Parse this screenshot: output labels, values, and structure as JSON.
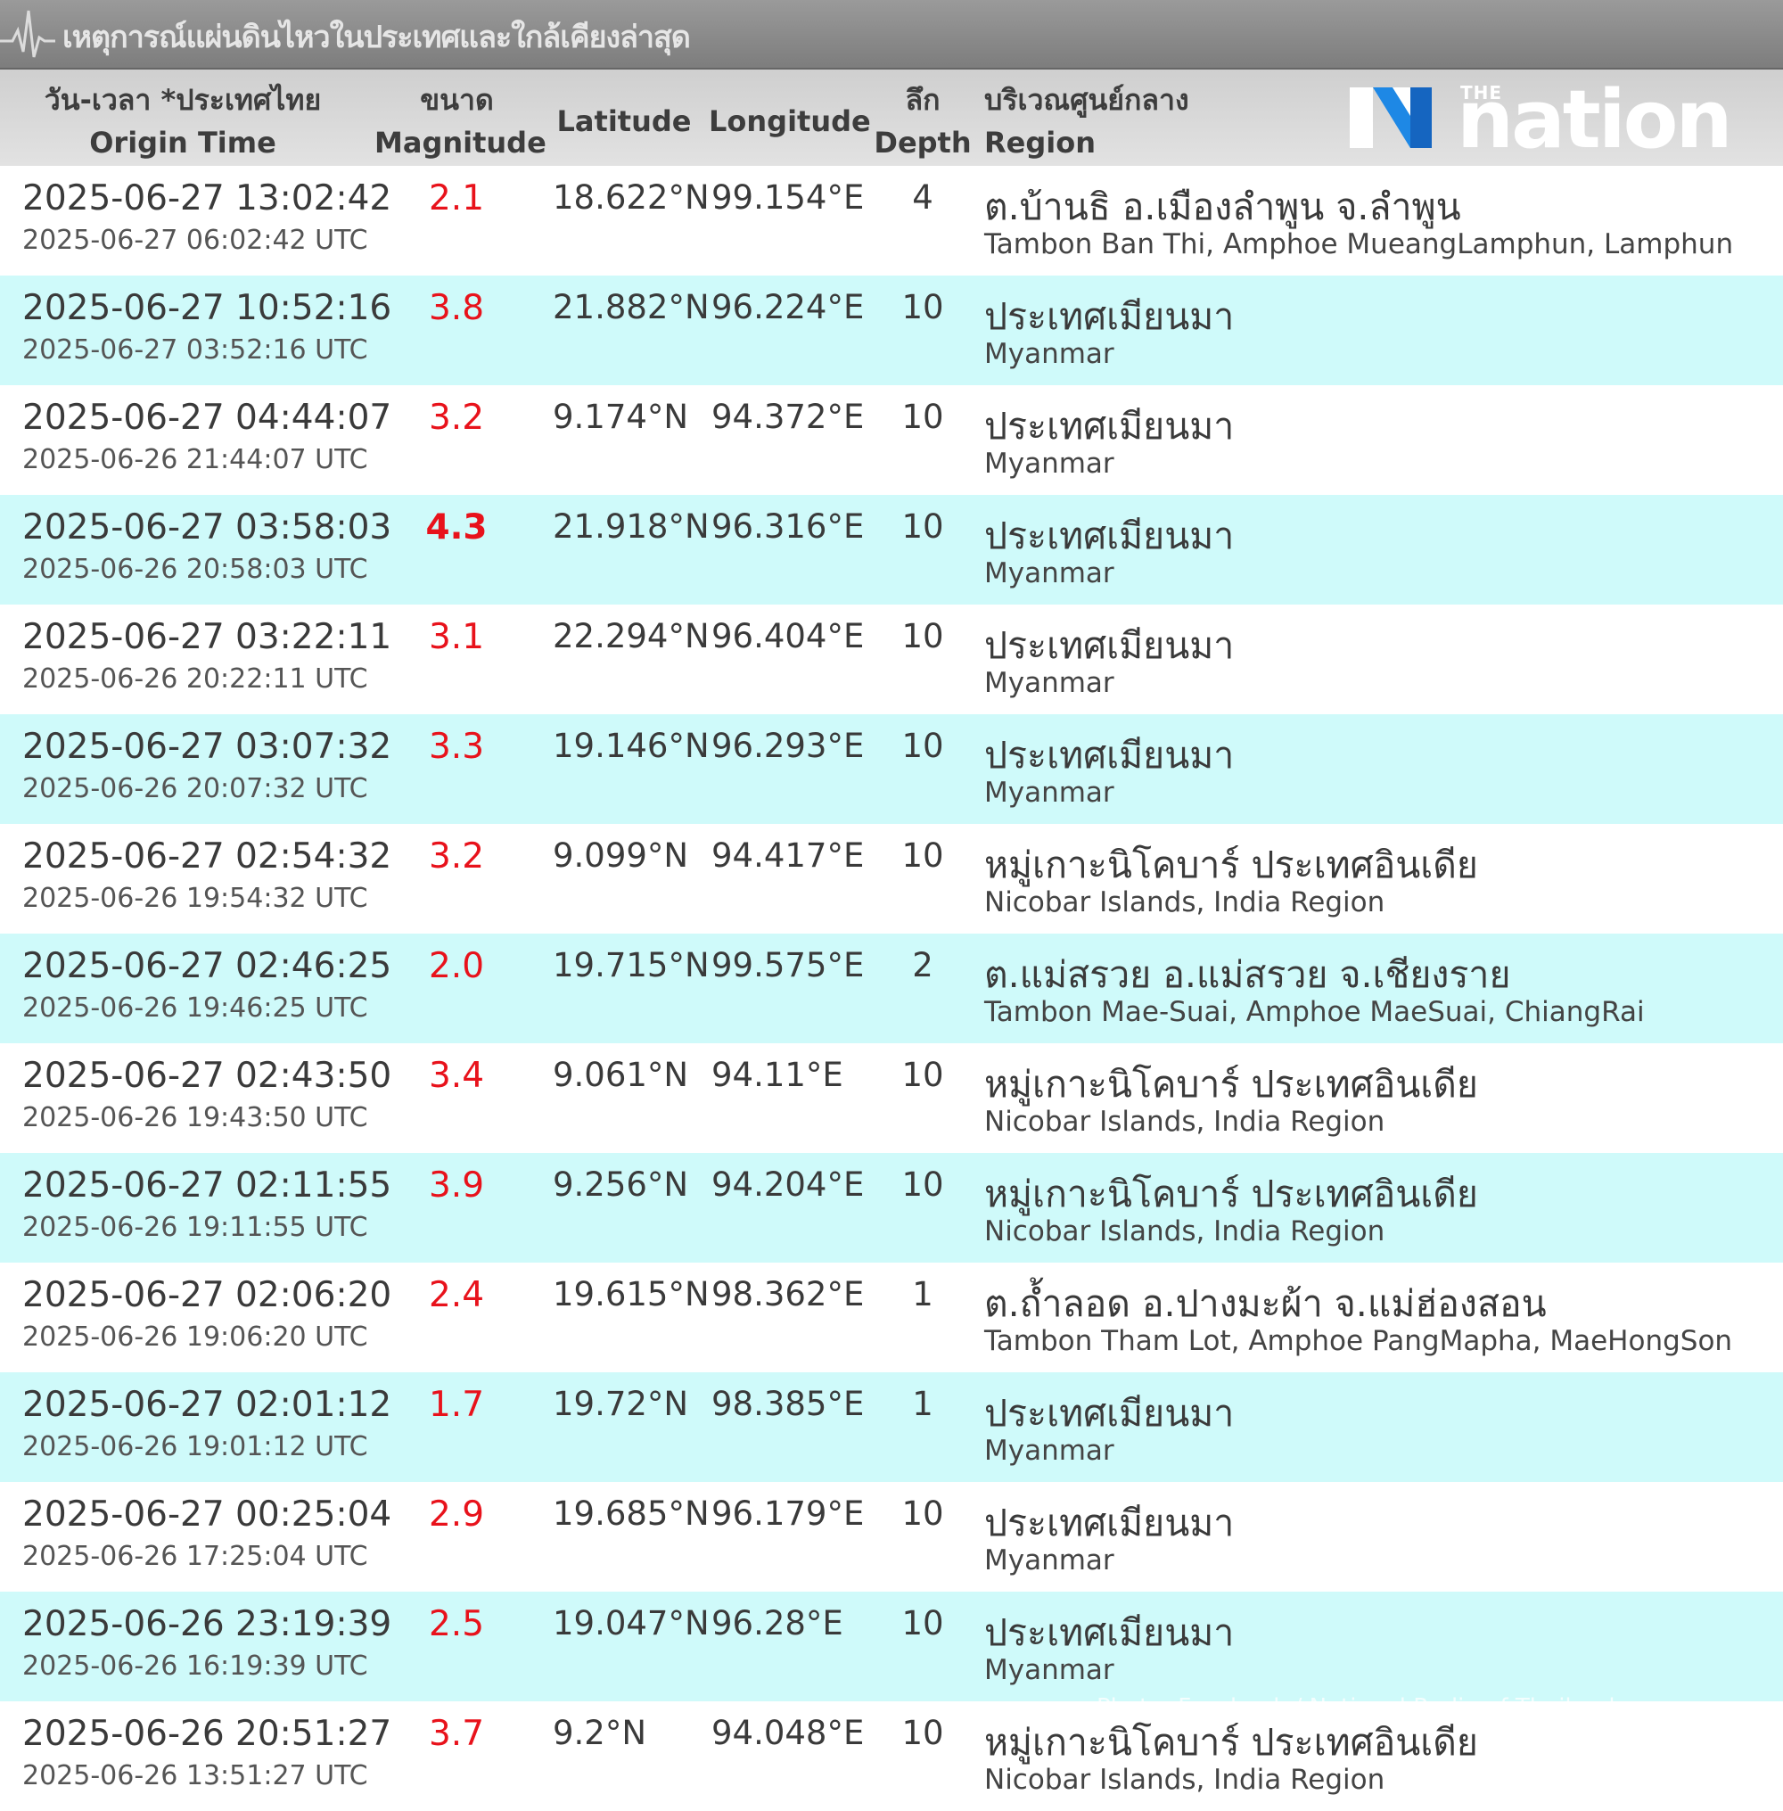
{
  "window": {
    "title": "เหตุการณ์แผ่นดินไหวในประเทศและใกล้เคียงล่าสุด"
  },
  "logo": {
    "small": "THE",
    "word": "nation",
    "brand_color": "#1e88e5"
  },
  "columns": {
    "time_th": "วัน-เวลา *ประเทศไทย",
    "time_en": "Origin Time",
    "mag_th": "ขนาด",
    "mag_en": "Magnitude",
    "lat": "Latitude",
    "lon": "Longitude",
    "depth_th": "ลึก",
    "depth_en": "Depth",
    "region_th": "บริเวณศูนย์กลาง",
    "region_en": "Region"
  },
  "colors": {
    "magnitude": "#e8121b",
    "alt_row": "#cffafa",
    "header_bg": "#d6d6d6"
  },
  "rows": [
    {
      "local": "2025-06-27 13:02:42",
      "utc": "2025-06-27 06:02:42 UTC",
      "mag": "2.1",
      "lat": "18.622°N",
      "lon": "99.154°E",
      "depth": "4",
      "region_th": "ต.บ้านธิ อ.เมืองลำพูน จ.ลำพูน",
      "region_en": "Tambon Ban Thi, Amphoe MueangLamphun, Lamphun"
    },
    {
      "local": "2025-06-27 10:52:16",
      "utc": "2025-06-27 03:52:16 UTC",
      "mag": "3.8",
      "lat": "21.882°N",
      "lon": "96.224°E",
      "depth": "10",
      "region_th": "ประเทศเมียนมา",
      "region_en": "Myanmar"
    },
    {
      "local": "2025-06-27 04:44:07",
      "utc": "2025-06-26 21:44:07 UTC",
      "mag": "3.2",
      "lat": "9.174°N",
      "lon": "94.372°E",
      "depth": "10",
      "region_th": "ประเทศเมียนมา",
      "region_en": "Myanmar"
    },
    {
      "local": "2025-06-27 03:58:03",
      "utc": "2025-06-26 20:58:03 UTC",
      "mag": "4.3",
      "lat": "21.918°N",
      "lon": "96.316°E",
      "depth": "10",
      "region_th": "ประเทศเมียนมา",
      "region_en": "Myanmar"
    },
    {
      "local": "2025-06-27 03:22:11",
      "utc": "2025-06-26 20:22:11 UTC",
      "mag": "3.1",
      "lat": "22.294°N",
      "lon": "96.404°E",
      "depth": "10",
      "region_th": "ประเทศเมียนมา",
      "region_en": "Myanmar"
    },
    {
      "local": "2025-06-27 03:07:32",
      "utc": "2025-06-26 20:07:32 UTC",
      "mag": "3.3",
      "lat": "19.146°N",
      "lon": "96.293°E",
      "depth": "10",
      "region_th": "ประเทศเมียนมา",
      "region_en": "Myanmar"
    },
    {
      "local": "2025-06-27 02:54:32",
      "utc": "2025-06-26 19:54:32 UTC",
      "mag": "3.2",
      "lat": "9.099°N",
      "lon": "94.417°E",
      "depth": "10",
      "region_th": "หมู่เกาะนิโคบาร์ ประเทศอินเดีย",
      "region_en": "Nicobar Islands, India Region"
    },
    {
      "local": "2025-06-27 02:46:25",
      "utc": "2025-06-26 19:46:25 UTC",
      "mag": "2.0",
      "lat": "19.715°N",
      "lon": "99.575°E",
      "depth": "2",
      "region_th": "ต.แม่สรวย อ.แม่สรวย จ.เชียงราย",
      "region_en": "Tambon Mae-Suai, Amphoe MaeSuai, ChiangRai"
    },
    {
      "local": "2025-06-27 02:43:50",
      "utc": "2025-06-26 19:43:50 UTC",
      "mag": "3.4",
      "lat": "9.061°N",
      "lon": "94.11°E",
      "depth": "10",
      "region_th": "หมู่เกาะนิโคบาร์ ประเทศอินเดีย",
      "region_en": "Nicobar Islands, India Region"
    },
    {
      "local": "2025-06-27 02:11:55",
      "utc": "2025-06-26 19:11:55 UTC",
      "mag": "3.9",
      "lat": "9.256°N",
      "lon": "94.204°E",
      "depth": "10",
      "region_th": "หมู่เกาะนิโคบาร์ ประเทศอินเดีย",
      "region_en": "Nicobar Islands, India Region"
    },
    {
      "local": "2025-06-27 02:06:20",
      "utc": "2025-06-26 19:06:20 UTC",
      "mag": "2.4",
      "lat": "19.615°N",
      "lon": "98.362°E",
      "depth": "1",
      "region_th": "ต.ถ้ำลอด อ.ปางมะผ้า จ.แม่ฮ่องสอน",
      "region_en": "Tambon Tham Lot, Amphoe PangMapha, MaeHongSon"
    },
    {
      "local": "2025-06-27 02:01:12",
      "utc": "2025-06-26 19:01:12 UTC",
      "mag": "1.7",
      "lat": "19.72°N",
      "lon": "98.385°E",
      "depth": "1",
      "region_th": "ประเทศเมียนมา",
      "region_en": "Myanmar"
    },
    {
      "local": "2025-06-27 00:25:04",
      "utc": "2025-06-26 17:25:04 UTC",
      "mag": "2.9",
      "lat": "19.685°N",
      "lon": "96.179°E",
      "depth": "10",
      "region_th": "ประเทศเมียนมา",
      "region_en": "Myanmar"
    },
    {
      "local": "2025-06-26 23:19:39",
      "utc": "2025-06-26 16:19:39 UTC",
      "mag": "2.5",
      "lat": "19.047°N",
      "lon": "96.28°E",
      "depth": "10",
      "region_th": "ประเทศเมียนมา",
      "region_en": "Myanmar"
    },
    {
      "local": "2025-06-26 20:51:27",
      "utc": "2025-06-26 13:51:27 UTC",
      "mag": "3.7",
      "lat": "9.2°N",
      "lon": "94.048°E",
      "depth": "10",
      "region_th": "หมู่เกาะนิโคบาร์ ประเทศอินเดีย",
      "region_en": "Nicobar Islands, India Region"
    }
  ],
  "watermark": "Photo: Facebook / National Radio of Thailand"
}
